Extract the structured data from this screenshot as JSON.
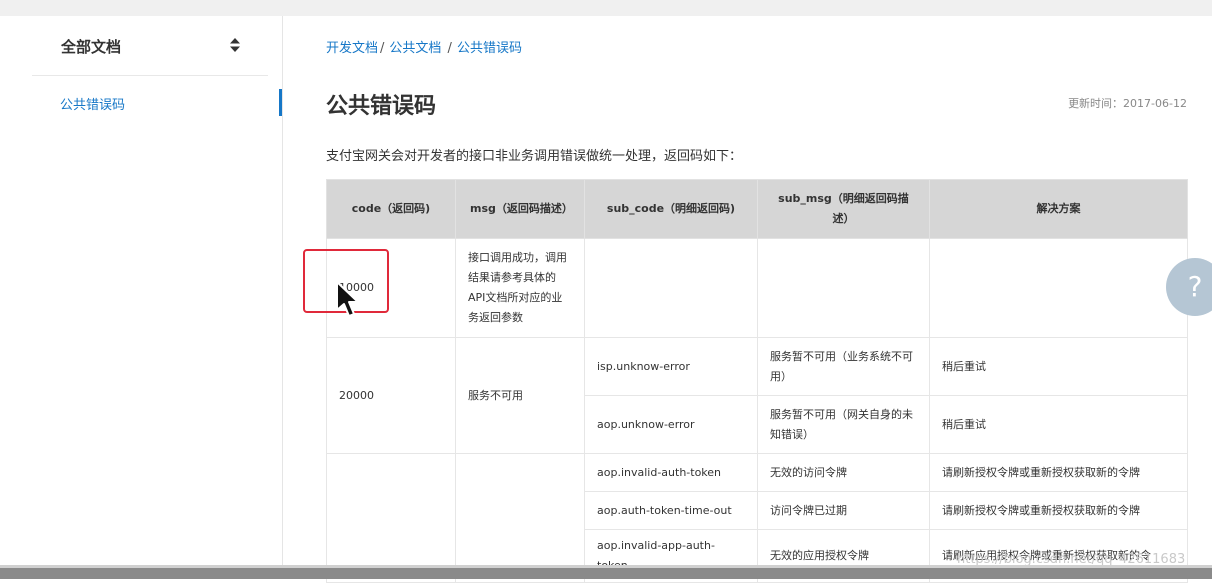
{
  "sidebar": {
    "title": "全部文档",
    "items": [
      {
        "label": "公共错误码",
        "active": true
      }
    ]
  },
  "breadcrumb": [
    "开发文档",
    "公共文档",
    "公共错误码"
  ],
  "page": {
    "title": "公共错误码",
    "update_time": "更新时间：2017-06-12",
    "intro": "支付宝网关会对开发者的接口非业务调用错误做统一处理，返回码如下："
  },
  "table": {
    "headers": [
      "code（返回码)",
      "msg（返回码描述）",
      "sub_code（明细返回码)",
      "sub_msg（明细返回码描述）",
      "解决方案"
    ],
    "rows": [
      {
        "code": "10000",
        "msg": "接口调用成功，调用结果请参考具体的API文档所对应的业务返回参数",
        "sub_code": "",
        "sub_msg": "",
        "solution": ""
      },
      {
        "code": "20000",
        "msg": "服务不可用",
        "sub_code": "isp.unknow-error",
        "sub_msg": "服务暂不可用（业务系统不可用）",
        "solution": "稍后重试"
      },
      {
        "code": "",
        "msg": "",
        "sub_code": "aop.unknow-error",
        "sub_msg": "服务暂不可用（网关自身的未知错误）",
        "solution": "稍后重试"
      },
      {
        "code": "",
        "msg": "",
        "sub_code": "aop.invalid-auth-token",
        "sub_msg": "无效的访问令牌",
        "solution": "请刷新授权令牌或重新授权获取新的令牌"
      },
      {
        "code": "",
        "msg": "",
        "sub_code": "aop.auth-token-time-out",
        "sub_msg": "访问令牌已过期",
        "solution": "请刷新授权令牌或重新授权获取新的令牌"
      },
      {
        "code": "",
        "msg": "",
        "sub_code": "aop.invalid-app-auth-token",
        "sub_msg": "无效的应用授权令牌",
        "solution": "请刷新应用授权令牌或重新授权获取新的令"
      }
    ]
  },
  "help_button": {
    "label": "?"
  },
  "watermark": "https://blog.csdn.net/qq_42611683",
  "colors": {
    "accent": "#1677c7",
    "header_bg": "#d6d6d6",
    "highlight": "#e0293a"
  },
  "icons": [
    "sort-icon",
    "cursor-icon",
    "help-icon"
  ]
}
